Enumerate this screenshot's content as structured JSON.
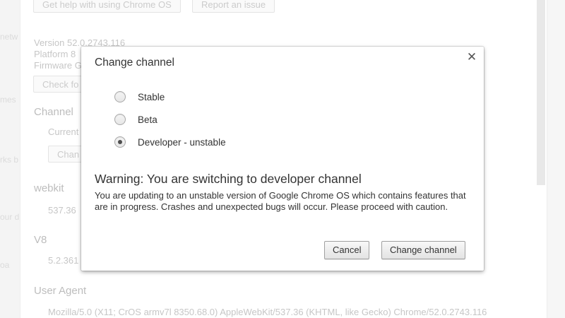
{
  "background": {
    "help_button": "Get help with using Chrome OS",
    "report_button": "Report an issue",
    "version": "Version 52.0.2743.116",
    "platform": "Platform 8",
    "firmware": "Firmware G",
    "check_button": "Check fo",
    "channel_heading": "Channel",
    "current_label": "Current",
    "change_button": "Chan",
    "webkit_heading": "webkit",
    "webkit_value": "537.36",
    "v8_heading": "V8",
    "v8_value": "5.2.361",
    "useragent_heading": "User Agent",
    "useragent_value": "Mozilla/5.0 (X11; CrOS armv7l 8350.68.0) AppleWebKit/537.36 (KHTML, like Gecko) Chrome/52.0.2743.116",
    "left_fragments": [
      "netw",
      "mes",
      "rks b",
      "our d",
      "oa"
    ]
  },
  "dialog": {
    "title": "Change channel",
    "close_icon": "close-icon",
    "options": [
      {
        "label": "Stable",
        "checked": false
      },
      {
        "label": "Beta",
        "checked": false
      },
      {
        "label": "Developer - unstable",
        "checked": true
      }
    ],
    "warning_title": "Warning: You are switching to developer channel",
    "warning_body": "You are updating to an unstable version of Google Chrome OS which contains features that are in progress. Crashes and unexpected bugs will occur. Please proceed with caution.",
    "cancel_label": "Cancel",
    "confirm_label": "Change channel"
  },
  "colors": {
    "dialog_bg": "#ffffff",
    "text": "#333333",
    "background_text": "#a8a8a8"
  }
}
